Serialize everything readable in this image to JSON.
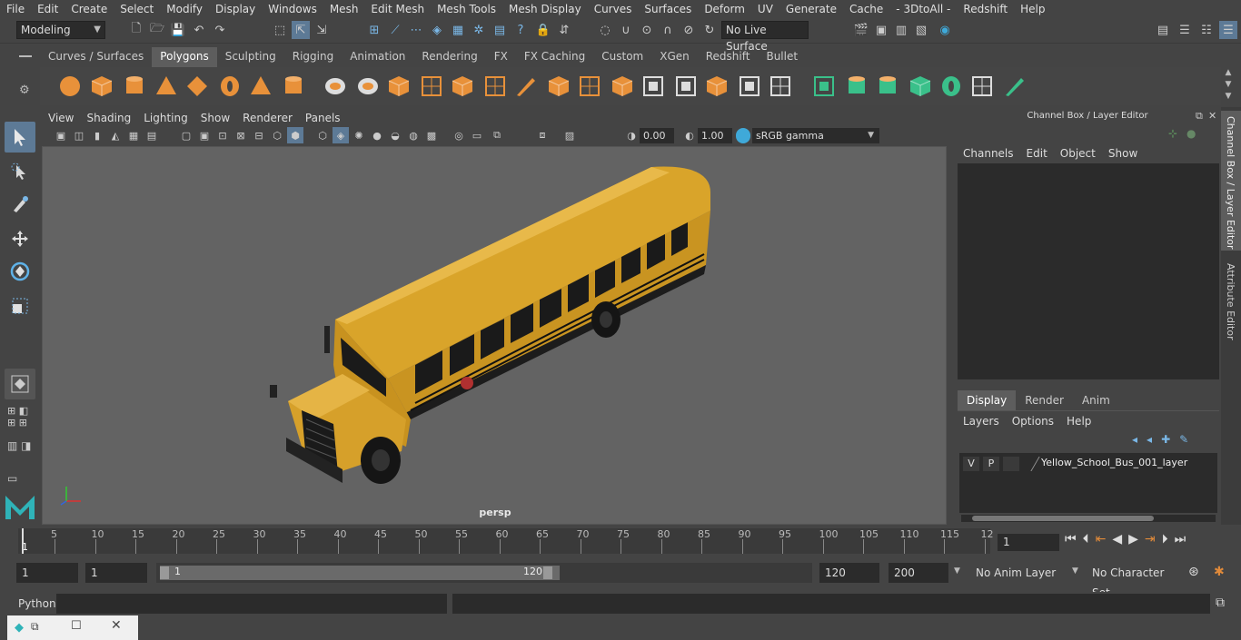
{
  "menu": [
    "File",
    "Edit",
    "Create",
    "Select",
    "Modify",
    "Display",
    "Windows",
    "Mesh",
    "Edit Mesh",
    "Mesh Tools",
    "Mesh Display",
    "Curves",
    "Surfaces",
    "Deform",
    "UV",
    "Generate",
    "Cache",
    "- 3DtoAll -",
    "Redshift",
    "Help"
  ],
  "status": {
    "mode": "Modeling",
    "live_surface": "No Live Surface"
  },
  "shelf": {
    "tabs": [
      "Curves / Surfaces",
      "Polygons",
      "Sculpting",
      "Rigging",
      "Animation",
      "Rendering",
      "FX",
      "FX Caching",
      "Custom",
      "XGen",
      "Redshift",
      "Bullet"
    ],
    "active": "Polygons"
  },
  "viewport": {
    "menu": [
      "View",
      "Shading",
      "Lighting",
      "Show",
      "Renderer",
      "Panels"
    ],
    "exposure": "0.00",
    "gamma": "1.00",
    "color_space": "sRGB gamma",
    "camera_label": "persp"
  },
  "channel_box": {
    "title": "Channel Box / Layer Editor",
    "menu": [
      "Channels",
      "Edit",
      "Object",
      "Show"
    ]
  },
  "layer_editor": {
    "tabs": [
      "Display",
      "Render",
      "Anim"
    ],
    "active_tab": "Display",
    "menu": [
      "Layers",
      "Options",
      "Help"
    ],
    "layers": [
      {
        "v": "V",
        "p": "P",
        "name": "Yellow_School_Bus_001_layer"
      }
    ]
  },
  "side_tabs": [
    "Channel Box / Layer Editor",
    "Attribute Editor"
  ],
  "timeline": {
    "ticks": [
      "5",
      "10",
      "15",
      "20",
      "25",
      "30",
      "35",
      "40",
      "45",
      "50",
      "55",
      "60",
      "65",
      "70",
      "75",
      "80",
      "85",
      "90",
      "95",
      "100",
      "105",
      "110",
      "115",
      "12"
    ],
    "first_tick": "1",
    "current_frame": "1"
  },
  "range": {
    "start": "1",
    "playback_start": "1",
    "slider_start": "1",
    "slider_end": "120",
    "playback_end": "120",
    "end": "200",
    "anim_layer": "No Anim Layer",
    "character_set": "No Character Set"
  },
  "command": {
    "label": "Python"
  },
  "colors": {
    "accent": "#5d9cc8",
    "bus_yellow": "#d9a42a",
    "viewport_bg": "#636363"
  }
}
